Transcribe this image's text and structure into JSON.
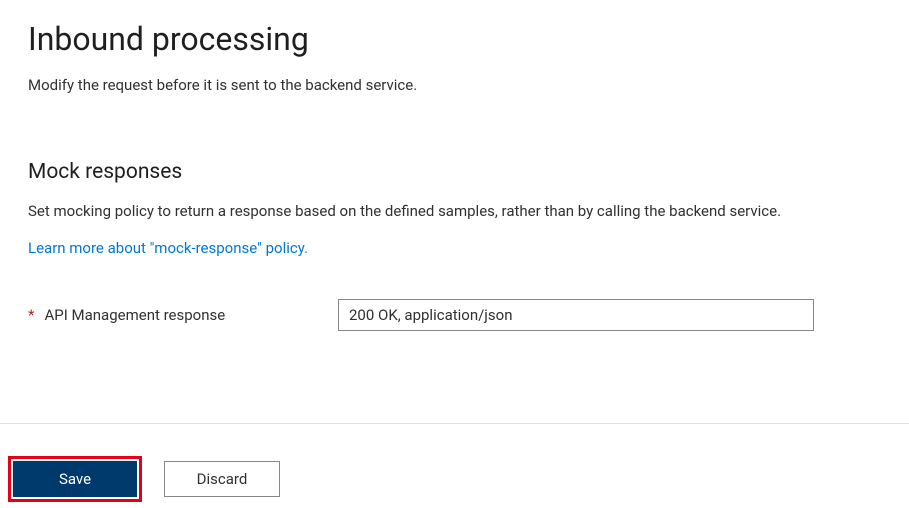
{
  "page": {
    "title": "Inbound processing",
    "subtitle": "Modify the request before it is sent to the backend service."
  },
  "mockResponses": {
    "sectionTitle": "Mock responses",
    "description": "Set mocking policy to return a response based on the defined samples, rather than by calling the backend service.",
    "learnMoreText": "Learn more about \"mock-response\" policy."
  },
  "form": {
    "requiredMarker": "*",
    "responseLabel": "API Management response",
    "responseValue": "200 OK, application/json"
  },
  "footer": {
    "saveLabel": "Save",
    "discardLabel": "Discard"
  }
}
